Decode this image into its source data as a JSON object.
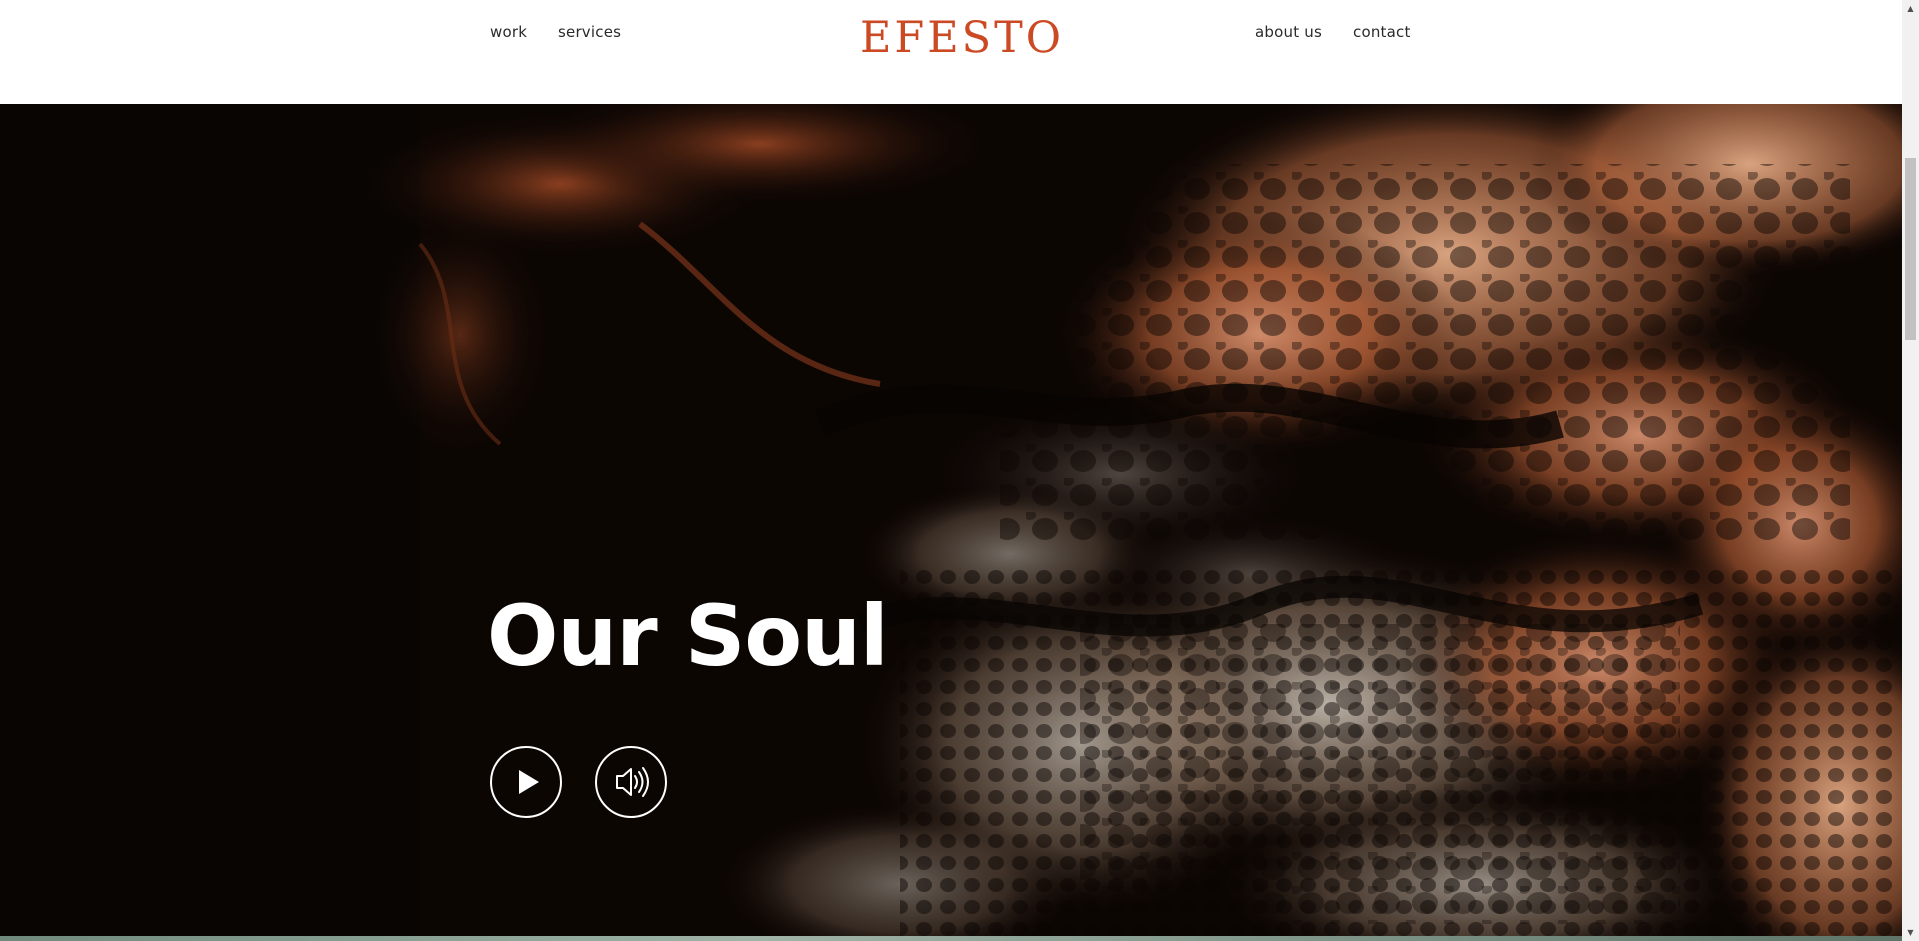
{
  "brand": {
    "logo_text": "EFESTO",
    "accent_color": "#cb4a24"
  },
  "nav": {
    "left": [
      {
        "label": "work"
      },
      {
        "label": "services"
      }
    ],
    "right": [
      {
        "label": "about us"
      },
      {
        "label": "contact"
      }
    ]
  },
  "hero": {
    "title": "Our Soul",
    "background": "dark abstract fluid-art with copper, orange and cream cells",
    "controls": {
      "play_icon": "play-icon",
      "sound_icon": "speaker-volume-icon"
    }
  },
  "colors": {
    "header_bg": "#ffffff",
    "nav_text": "#2b2b2b",
    "hero_text": "#ffffff",
    "hero_base": "#0e0704"
  }
}
